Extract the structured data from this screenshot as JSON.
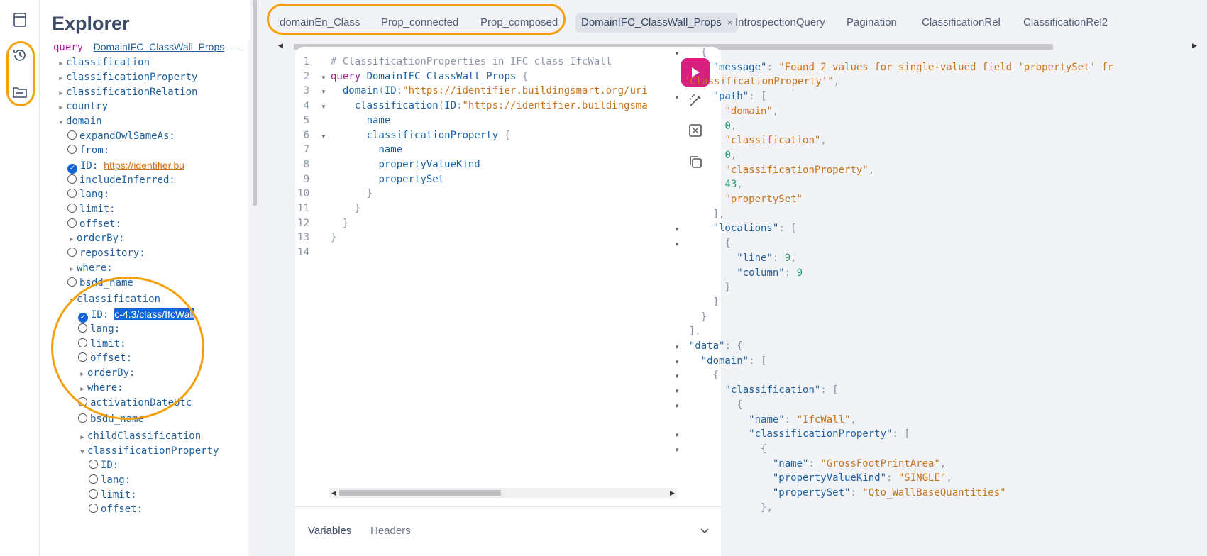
{
  "explorer": {
    "title": "Explorer",
    "query_keyword": "query",
    "query_name": "DomainIFC_ClassWall_Props",
    "rows": [
      {
        "indent": 0,
        "kind": "tri-right",
        "label": "classification"
      },
      {
        "indent": 0,
        "kind": "tri-right",
        "label": "classificationProperty"
      },
      {
        "indent": 0,
        "kind": "tri-right",
        "label": "classificationRelation"
      },
      {
        "indent": 0,
        "kind": "tri-right",
        "label": "country"
      },
      {
        "indent": 0,
        "kind": "tri-down",
        "label": "domain"
      },
      {
        "indent": 1,
        "kind": "radio",
        "label": "expandOwlSameAs:"
      },
      {
        "indent": 1,
        "kind": "radio",
        "label": "from:"
      },
      {
        "indent": 1,
        "kind": "check",
        "label": "ID:",
        "value": "https://identifier.bu",
        "value_style": "link"
      },
      {
        "indent": 1,
        "kind": "radio",
        "label": "includeInferred:"
      },
      {
        "indent": 1,
        "kind": "radio",
        "label": "lang:"
      },
      {
        "indent": 1,
        "kind": "radio",
        "label": "limit:"
      },
      {
        "indent": 1,
        "kind": "radio",
        "label": "offset:"
      },
      {
        "indent": 1,
        "kind": "tri-right",
        "label": "orderBy:"
      },
      {
        "indent": 1,
        "kind": "radio",
        "label": "repository:"
      },
      {
        "indent": 1,
        "kind": "tri-right",
        "label": "where:"
      },
      {
        "indent": 1,
        "kind": "radio",
        "label": "bsdd_name"
      },
      {
        "indent": 1,
        "kind": "tri-down",
        "label": "classification"
      },
      {
        "indent": 2,
        "kind": "check",
        "label": "ID:",
        "value": "c-4.3/class/IfcWall",
        "value_style": "sel"
      },
      {
        "indent": 2,
        "kind": "radio",
        "label": "lang:"
      },
      {
        "indent": 2,
        "kind": "radio",
        "label": "limit:"
      },
      {
        "indent": 2,
        "kind": "radio",
        "label": "offset:"
      },
      {
        "indent": 2,
        "kind": "tri-right",
        "label": "orderBy:"
      },
      {
        "indent": 2,
        "kind": "tri-right",
        "label": "where:"
      },
      {
        "indent": 2,
        "kind": "radio",
        "label": "activationDateUtc"
      },
      {
        "indent": 2,
        "kind": "radio",
        "label": "bsdd_name"
      },
      {
        "indent": 2,
        "kind": "tri-right",
        "label": "childClassification"
      },
      {
        "indent": 2,
        "kind": "tri-down",
        "label": "classificationProperty"
      },
      {
        "indent": 3,
        "kind": "radio",
        "label": "ID:"
      },
      {
        "indent": 3,
        "kind": "radio",
        "label": "lang:"
      },
      {
        "indent": 3,
        "kind": "radio",
        "label": "limit:"
      },
      {
        "indent": 3,
        "kind": "radio",
        "label": "offset:"
      }
    ]
  },
  "tabs": [
    {
      "label": "domainEn_Class",
      "active": false
    },
    {
      "label": "Prop_connected",
      "active": false
    },
    {
      "label": "Prop_composed",
      "active": false
    },
    {
      "label": "DomainIFC_ClassWall_Props",
      "active": true,
      "close": "×"
    },
    {
      "label": "IntrospectionQuery",
      "active": false
    },
    {
      "label": "Pagination",
      "active": false
    },
    {
      "label": "ClassificationRel",
      "active": false
    },
    {
      "label": "ClassificationRel2",
      "active": false
    }
  ],
  "editor": {
    "lines": [
      [
        {
          "t": "# ClassificationProperties in IFC class IfcWall",
          "c": "comment"
        }
      ],
      [
        {
          "t": "query ",
          "c": "kw"
        },
        {
          "t": "DomainIFC_ClassWall_Props",
          "c": "def"
        },
        {
          "t": " {",
          "c": "punc"
        }
      ],
      [
        {
          "t": "  ",
          "c": ""
        },
        {
          "t": "domain",
          "c": "field"
        },
        {
          "t": "(",
          "c": "punc"
        },
        {
          "t": "ID",
          "c": "field"
        },
        {
          "t": ":",
          "c": "punc"
        },
        {
          "t": "\"https://identifier.buildingsmart.org/uri",
          "c": "str"
        }
      ],
      [
        {
          "t": "    ",
          "c": ""
        },
        {
          "t": "classification",
          "c": "field"
        },
        {
          "t": "(",
          "c": "punc"
        },
        {
          "t": "ID",
          "c": "field"
        },
        {
          "t": ":",
          "c": "punc"
        },
        {
          "t": "\"https://identifier.buildingsma",
          "c": "str"
        }
      ],
      [
        {
          "t": "      ",
          "c": ""
        },
        {
          "t": "name",
          "c": "field"
        }
      ],
      [
        {
          "t": "      ",
          "c": ""
        },
        {
          "t": "classificationProperty",
          "c": "field"
        },
        {
          "t": " {",
          "c": "punc"
        }
      ],
      [
        {
          "t": "        ",
          "c": ""
        },
        {
          "t": "name",
          "c": "field"
        }
      ],
      [
        {
          "t": "        ",
          "c": ""
        },
        {
          "t": "propertyValueKind",
          "c": "field"
        }
      ],
      [
        {
          "t": "        ",
          "c": ""
        },
        {
          "t": "propertySet",
          "c": "field"
        }
      ],
      [
        {
          "t": "      }",
          "c": "punc"
        }
      ],
      [
        {
          "t": "    }",
          "c": "punc"
        }
      ],
      [
        {
          "t": "  }",
          "c": "punc"
        }
      ],
      [
        {
          "t": "}",
          "c": "punc"
        }
      ],
      []
    ],
    "line_numbers": [
      "1",
      "2",
      "3",
      "4",
      "5",
      "6",
      "7",
      "8",
      "9",
      "10",
      "11",
      "12",
      "13",
      "14"
    ],
    "folds": [
      false,
      true,
      true,
      true,
      false,
      true,
      false,
      false,
      false,
      false,
      false,
      false,
      false,
      false
    ],
    "bottom_tabs": {
      "variables": "Variables",
      "headers": "Headers"
    }
  },
  "result": {
    "lines": [
      {
        "fold": true,
        "parts": [
          {
            "t": "    {",
            "c": "p"
          }
        ]
      },
      {
        "fold": false,
        "parts": [
          {
            "t": "      ",
            "c": "p"
          },
          {
            "t": "\"message\"",
            "c": "k"
          },
          {
            "t": ": ",
            "c": "p"
          },
          {
            "t": "\"Found 2 values for single-valued field 'propertySet' fr",
            "c": "s"
          }
        ]
      },
      {
        "fold": false,
        "parts": [
          {
            "t": "",
            "c": "p"
          },
          {
            "t": "'ClassificationProperty'\"",
            "c": "s"
          },
          {
            "t": ",",
            "c": "p"
          }
        ]
      },
      {
        "fold": true,
        "parts": [
          {
            "t": "      ",
            "c": "p"
          },
          {
            "t": "\"path\"",
            "c": "k"
          },
          {
            "t": ": [",
            "c": "p"
          }
        ]
      },
      {
        "fold": false,
        "parts": [
          {
            "t": "        ",
            "c": "p"
          },
          {
            "t": "\"domain\"",
            "c": "s"
          },
          {
            "t": ",",
            "c": "p"
          }
        ]
      },
      {
        "fold": false,
        "parts": [
          {
            "t": "        ",
            "c": "p"
          },
          {
            "t": "0",
            "c": "n"
          },
          {
            "t": ",",
            "c": "p"
          }
        ]
      },
      {
        "fold": false,
        "parts": [
          {
            "t": "        ",
            "c": "p"
          },
          {
            "t": "\"classification\"",
            "c": "s"
          },
          {
            "t": ",",
            "c": "p"
          }
        ]
      },
      {
        "fold": false,
        "parts": [
          {
            "t": "        ",
            "c": "p"
          },
          {
            "t": "0",
            "c": "n"
          },
          {
            "t": ",",
            "c": "p"
          }
        ]
      },
      {
        "fold": false,
        "parts": [
          {
            "t": "        ",
            "c": "p"
          },
          {
            "t": "\"classificationProperty\"",
            "c": "s"
          },
          {
            "t": ",",
            "c": "p"
          }
        ]
      },
      {
        "fold": false,
        "parts": [
          {
            "t": "        ",
            "c": "p"
          },
          {
            "t": "43",
            "c": "n"
          },
          {
            "t": ",",
            "c": "p"
          }
        ]
      },
      {
        "fold": false,
        "parts": [
          {
            "t": "        ",
            "c": "p"
          },
          {
            "t": "\"propertySet\"",
            "c": "s"
          }
        ]
      },
      {
        "fold": false,
        "parts": [
          {
            "t": "      ],",
            "c": "p"
          }
        ]
      },
      {
        "fold": true,
        "parts": [
          {
            "t": "      ",
            "c": "p"
          },
          {
            "t": "\"locations\"",
            "c": "k"
          },
          {
            "t": ": [",
            "c": "p"
          }
        ]
      },
      {
        "fold": true,
        "parts": [
          {
            "t": "        {",
            "c": "p"
          }
        ]
      },
      {
        "fold": false,
        "parts": [
          {
            "t": "          ",
            "c": "p"
          },
          {
            "t": "\"line\"",
            "c": "k"
          },
          {
            "t": ": ",
            "c": "p"
          },
          {
            "t": "9",
            "c": "n"
          },
          {
            "t": ",",
            "c": "p"
          }
        ]
      },
      {
        "fold": false,
        "parts": [
          {
            "t": "          ",
            "c": "p"
          },
          {
            "t": "\"column\"",
            "c": "k"
          },
          {
            "t": ": ",
            "c": "p"
          },
          {
            "t": "9",
            "c": "n"
          }
        ]
      },
      {
        "fold": false,
        "parts": [
          {
            "t": "        }",
            "c": "p"
          }
        ]
      },
      {
        "fold": false,
        "parts": [
          {
            "t": "      ]",
            "c": "p"
          }
        ]
      },
      {
        "fold": false,
        "parts": [
          {
            "t": "    }",
            "c": "p"
          }
        ]
      },
      {
        "fold": false,
        "parts": [
          {
            "t": "  ],",
            "c": "p"
          }
        ]
      },
      {
        "fold": true,
        "parts": [
          {
            "t": "  ",
            "c": "p"
          },
          {
            "t": "\"data\"",
            "c": "k"
          },
          {
            "t": ": {",
            "c": "p"
          }
        ]
      },
      {
        "fold": true,
        "parts": [
          {
            "t": "    ",
            "c": "p"
          },
          {
            "t": "\"domain\"",
            "c": "k"
          },
          {
            "t": ": [",
            "c": "p"
          }
        ]
      },
      {
        "fold": true,
        "parts": [
          {
            "t": "      {",
            "c": "p"
          }
        ]
      },
      {
        "fold": true,
        "parts": [
          {
            "t": "        ",
            "c": "p"
          },
          {
            "t": "\"classification\"",
            "c": "k"
          },
          {
            "t": ": [",
            "c": "p"
          }
        ]
      },
      {
        "fold": true,
        "parts": [
          {
            "t": "          {",
            "c": "p"
          }
        ]
      },
      {
        "fold": false,
        "parts": [
          {
            "t": "            ",
            "c": "p"
          },
          {
            "t": "\"name\"",
            "c": "k"
          },
          {
            "t": ": ",
            "c": "p"
          },
          {
            "t": "\"IfcWall\"",
            "c": "s"
          },
          {
            "t": ",",
            "c": "p"
          }
        ]
      },
      {
        "fold": true,
        "parts": [
          {
            "t": "            ",
            "c": "p"
          },
          {
            "t": "\"classificationProperty\"",
            "c": "k"
          },
          {
            "t": ": [",
            "c": "p"
          }
        ]
      },
      {
        "fold": true,
        "parts": [
          {
            "t": "              {",
            "c": "p"
          }
        ]
      },
      {
        "fold": false,
        "parts": [
          {
            "t": "                ",
            "c": "p"
          },
          {
            "t": "\"name\"",
            "c": "k"
          },
          {
            "t": ": ",
            "c": "p"
          },
          {
            "t": "\"GrossFootPrintArea\"",
            "c": "s"
          },
          {
            "t": ",",
            "c": "p"
          }
        ]
      },
      {
        "fold": false,
        "parts": [
          {
            "t": "                ",
            "c": "p"
          },
          {
            "t": "\"propertyValueKind\"",
            "c": "k"
          },
          {
            "t": ": ",
            "c": "p"
          },
          {
            "t": "\"SINGLE\"",
            "c": "s"
          },
          {
            "t": ",",
            "c": "p"
          }
        ]
      },
      {
        "fold": false,
        "parts": [
          {
            "t": "                ",
            "c": "p"
          },
          {
            "t": "\"propertySet\"",
            "c": "k"
          },
          {
            "t": ": ",
            "c": "p"
          },
          {
            "t": "\"Qto_WallBaseQuantities\"",
            "c": "s"
          }
        ]
      },
      {
        "fold": false,
        "parts": [
          {
            "t": "              },",
            "c": "p"
          }
        ]
      }
    ]
  },
  "colors": {
    "accent_run": "#d61f7e",
    "annotation": "#f5a00a",
    "checkbox": "#1466d6"
  }
}
